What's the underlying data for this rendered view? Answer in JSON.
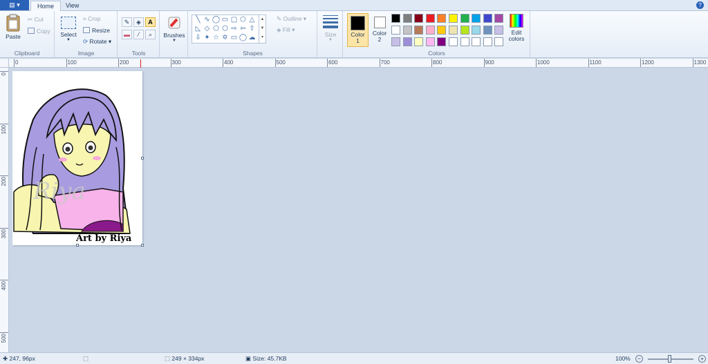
{
  "tabs": {
    "file_label": "▤ ▾",
    "home": "Home",
    "view": "View",
    "help": "?"
  },
  "clipboard": {
    "paste": "Paste",
    "cut": "Cut",
    "copy": "Copy",
    "label": "Clipboard"
  },
  "image": {
    "select": "Select",
    "crop": "Crop",
    "resize": "Resize",
    "rotate": "Rotate",
    "label": "Image"
  },
  "tools": {
    "label": "Tools"
  },
  "brushes": {
    "label": "Brushes"
  },
  "shapes": {
    "outline": "Outline",
    "fill": "Fill",
    "label": "Shapes"
  },
  "size": {
    "label": "Size"
  },
  "colors": {
    "color1": "Color 1",
    "color2": "Color 2",
    "edit": "Edit colors",
    "label": "Colors",
    "row1": [
      "#000000",
      "#7f7f7f",
      "#880015",
      "#ed1c24",
      "#ff7f27",
      "#fff200",
      "#22b14c",
      "#00a2e8",
      "#3f48cc",
      "#a349a4"
    ],
    "row2": [
      "#ffffff",
      "#c3c3c3",
      "#b97a57",
      "#ffaec9",
      "#ffc90e",
      "#efe4b0",
      "#b5e61d",
      "#99d9ea",
      "#7092be",
      "#c8bfe7"
    ],
    "row3": [
      "#c8bfe7",
      "#9d8ed8",
      "#ffffc0",
      "#ffb8f0",
      "#800080",
      "#ffffff",
      "#ffffff",
      "#ffffff",
      "#ffffff",
      "#ffffff"
    ]
  },
  "ruler_h": [
    "0",
    "100",
    "200",
    "300",
    "400",
    "500",
    "600",
    "700",
    "800",
    "900",
    "1000",
    "1100",
    "1200",
    "1300"
  ],
  "ruler_v": [
    "0",
    "100",
    "200",
    "300",
    "400",
    "500"
  ],
  "artwork": {
    "signature": "Art by Riya",
    "watermark": "Riya"
  },
  "status": {
    "cursor": "247, 96px",
    "selection": "",
    "size": "249 × 334px",
    "filesize": "Size: 45.7KB",
    "zoom": "100%"
  }
}
